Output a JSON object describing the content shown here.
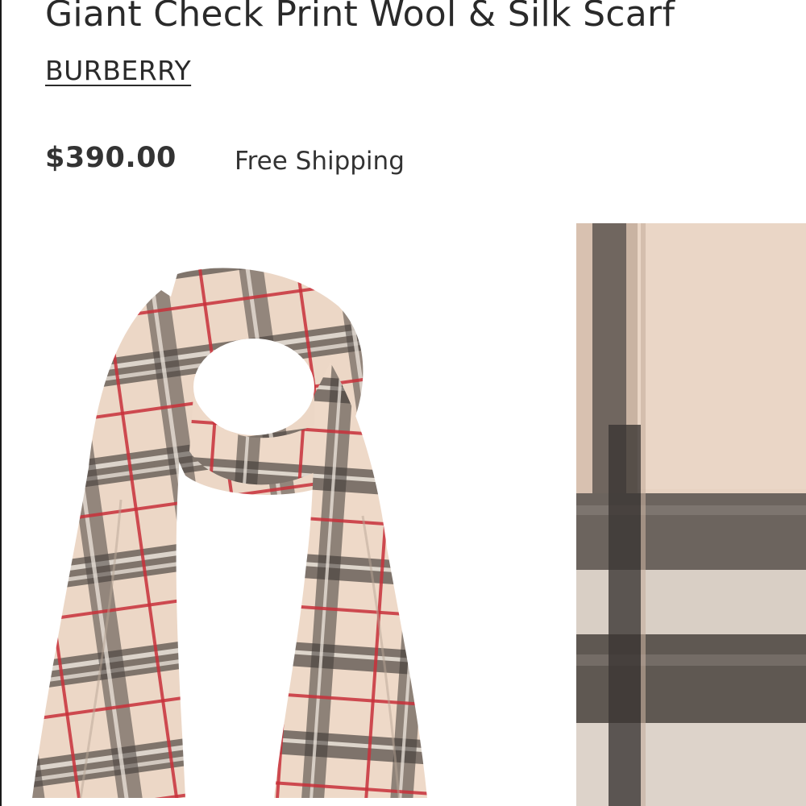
{
  "product": {
    "title": "Giant Check Print Wool & Silk Scarf",
    "brand": "BURBERRY",
    "price": "$390.00",
    "shipping": "Free Shipping"
  },
  "images": {
    "main": "scarf-product-photo",
    "detail": "scarf-fabric-closeup"
  },
  "colors": {
    "text": "#2a2a2a",
    "scarf_base": "#e8d3c2",
    "check_dark": "#3e3a37",
    "check_red": "#c8303a"
  }
}
